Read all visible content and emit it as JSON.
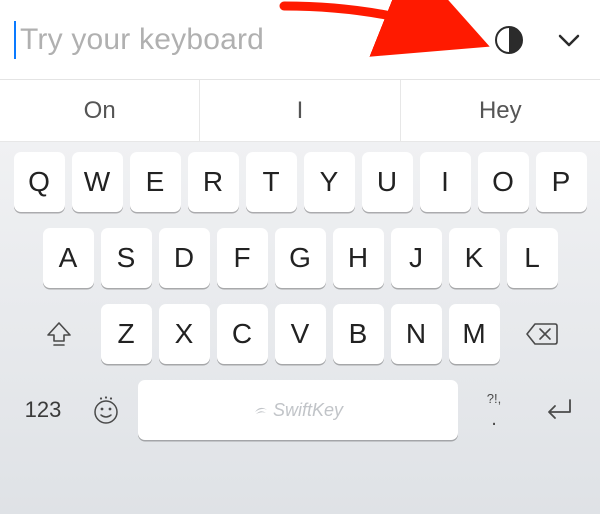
{
  "input": {
    "placeholder": "Try your keyboard"
  },
  "suggestions": [
    "On",
    "I",
    "Hey"
  ],
  "rows": {
    "r1": [
      "Q",
      "W",
      "E",
      "R",
      "T",
      "Y",
      "U",
      "I",
      "O",
      "P"
    ],
    "r2": [
      "A",
      "S",
      "D",
      "F",
      "G",
      "H",
      "J",
      "K",
      "L"
    ],
    "r3": [
      "Z",
      "X",
      "C",
      "V",
      "B",
      "N",
      "M"
    ]
  },
  "bottom": {
    "mode": "123",
    "space_brand": "SwiftKey",
    "punct_top": "?!,",
    "punct_bot": "."
  },
  "annotation": {
    "type": "arrow",
    "target": "theme-toggle-button",
    "color": "#ff0000"
  }
}
